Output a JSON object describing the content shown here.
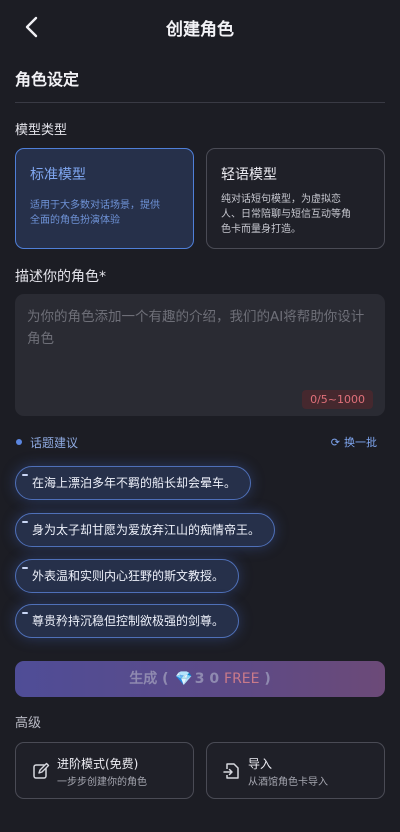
{
  "header": {
    "title": "创建角色"
  },
  "section": {
    "title": "角色设定"
  },
  "model": {
    "label": "模型类型",
    "standard": {
      "name": "标准模型",
      "desc_line1": "适用于大多数对话场景，提供",
      "desc_line2": "全面的角色扮演体验"
    },
    "light": {
      "name": "轻语模型",
      "desc_line1": "纯对话短句模型，为虚拟恋",
      "desc_line2": "人、日常陪聊与短信互动等角",
      "desc_line3": "色卡而量身打造。"
    }
  },
  "description": {
    "label": "描述你的角色*",
    "placeholder": "为你的角色添加一个有趣的介绍，我们的AI将帮助你设计角色",
    "counter": "0/5~1000"
  },
  "suggestions": {
    "label": "话题建议",
    "refresh": "换一批",
    "items": [
      "在海上漂泊多年不羁的船长却会晕车。",
      "身为太子却甘愿为爱放弃江山的痴情帝王。",
      "外表温和实则内心狂野的斯文教授。",
      "尊贵矜持沉稳但控制欲极强的剑尊。"
    ]
  },
  "generate": {
    "label": "生成",
    "open": "(",
    "gem": "💎",
    "cost": "3 0",
    "free": "FREE",
    "close": ")"
  },
  "advanced": {
    "label": "高级",
    "advance_mode": {
      "title": "进阶模式(免费)",
      "subtitle": "一步步创建你的角色"
    },
    "import": {
      "title": "导入",
      "subtitle": "从酒馆角色卡导入"
    }
  },
  "colors": {
    "accent": "#4f7fd8",
    "background": "#1c1d24",
    "card": "#1f2028",
    "counter_text": "#e0707a"
  }
}
